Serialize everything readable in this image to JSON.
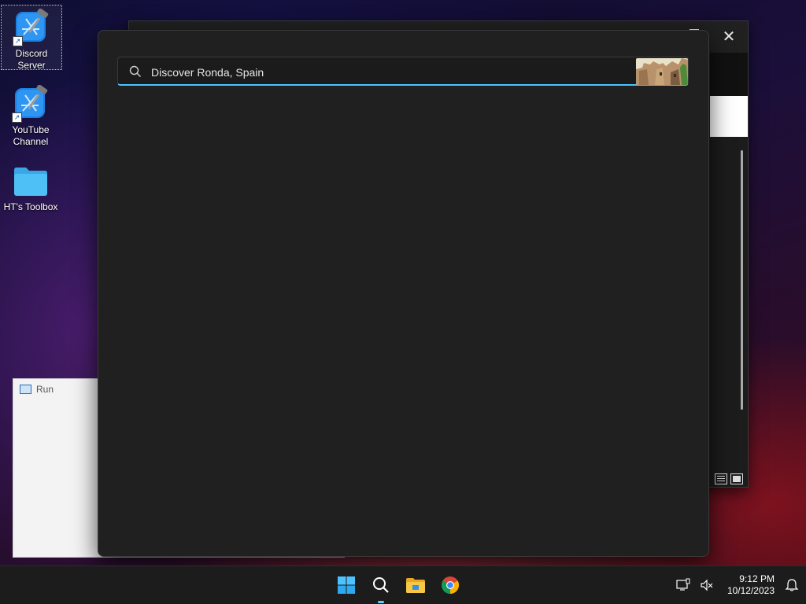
{
  "desktop": {
    "icons": [
      {
        "label": "Discord Server",
        "icon": "xcode-hammer-icon"
      },
      {
        "label": "YouTube Channel",
        "icon": "xcode-hammer-icon"
      },
      {
        "label": "HT's Toolbox",
        "icon": "folder-icon"
      }
    ]
  },
  "run_dialog": {
    "title": "Run"
  },
  "search": {
    "value": "Discover Ronda, Spain",
    "placeholder": "Discover Ronda, Spain",
    "highlight_image": "ronda-spain-thumbnail"
  },
  "taskbar": {
    "buttons": [
      "start-icon",
      "search-icon",
      "file-explorer-icon",
      "chrome-icon"
    ],
    "clock_time": "9:12 PM",
    "clock_date": "10/12/2023"
  },
  "colors": {
    "accent": "#4cc2ff",
    "panel_bg": "#202020",
    "taskbar_bg": "#1c1c1c"
  }
}
